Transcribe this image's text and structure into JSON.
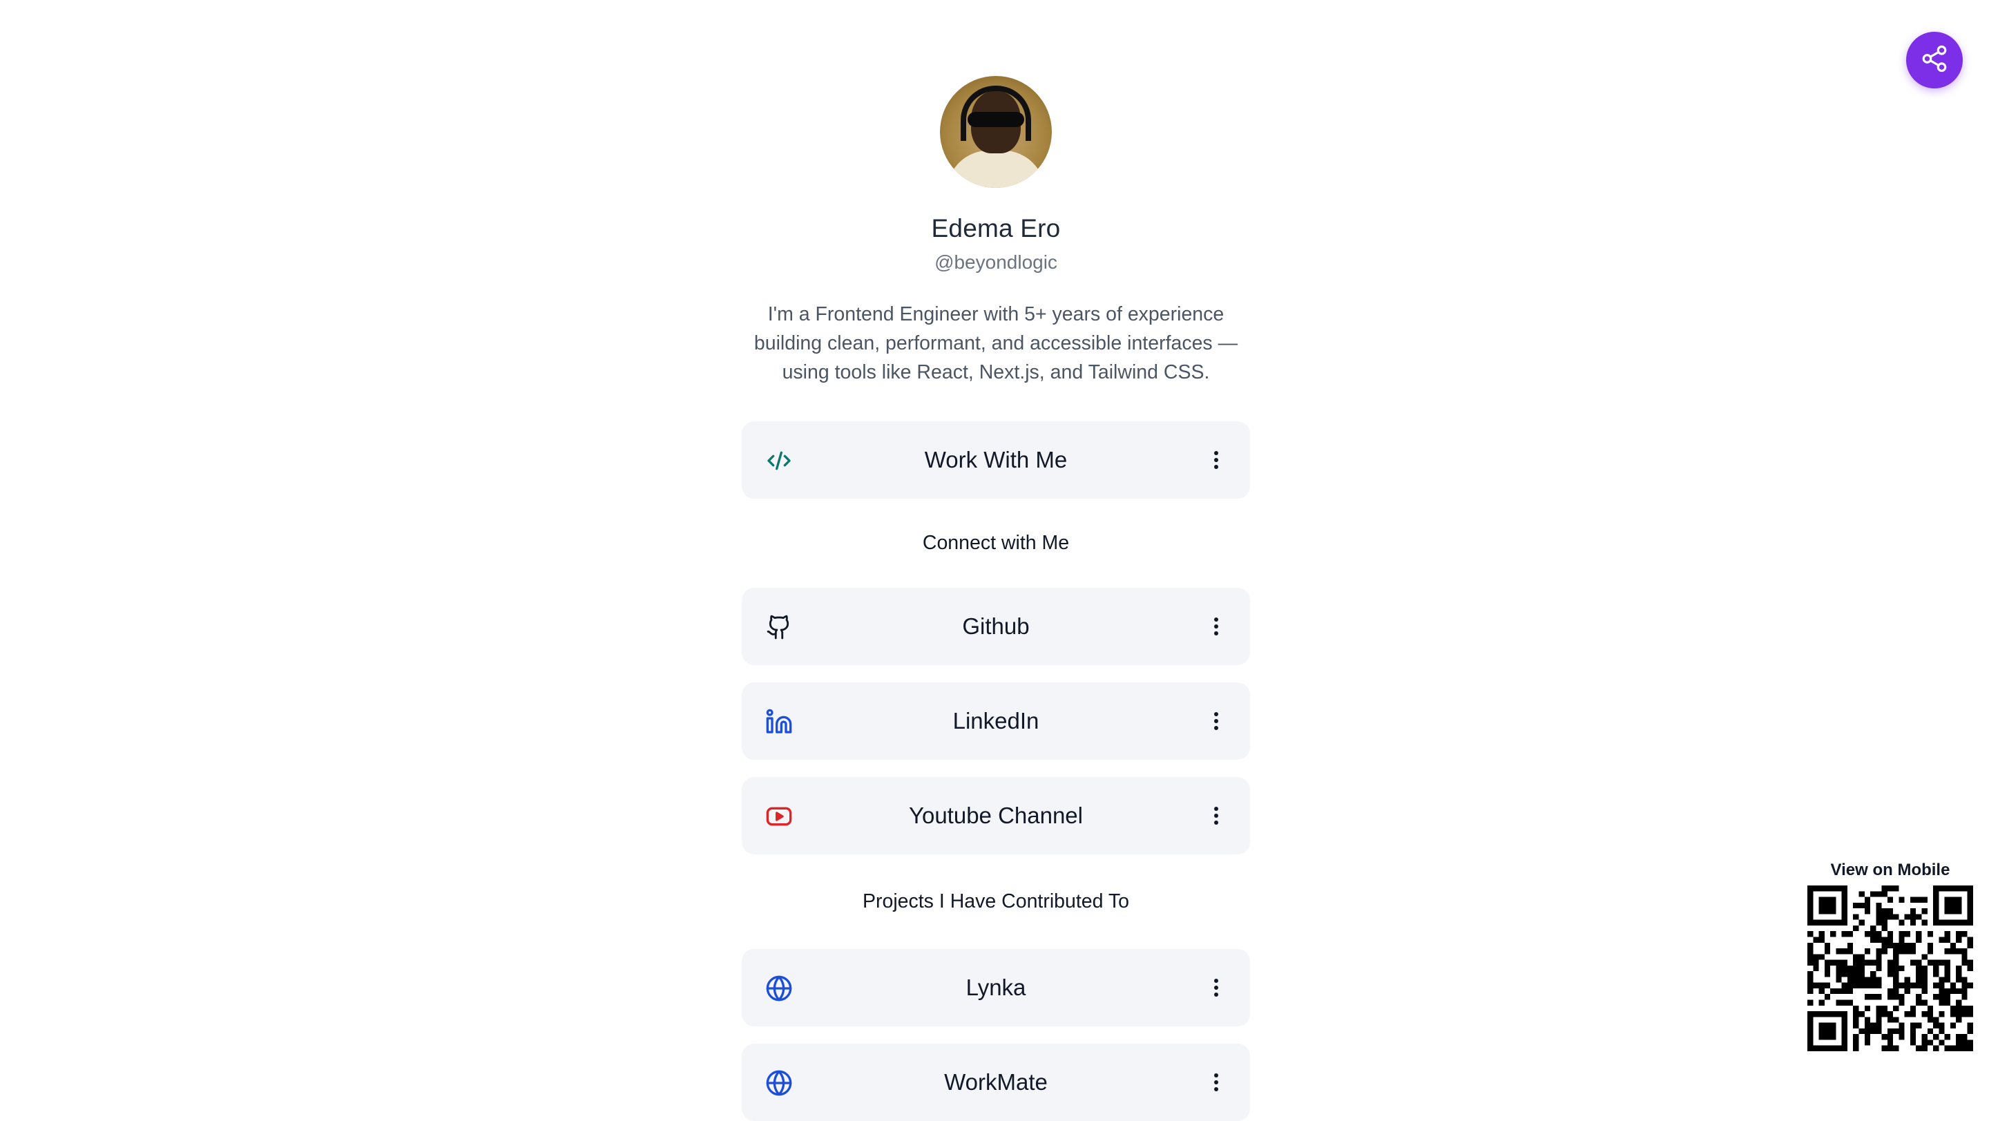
{
  "profile": {
    "name": "Edema Ero",
    "handle": "@beyondlogic",
    "bio": "I'm a Frontend Engineer with 5+ years of experience building clean, performant, and accessible interfaces — using tools like React, Next.js, and Tailwind CSS."
  },
  "links": {
    "work": {
      "label": "Work With Me",
      "icon": "code-icon",
      "color": "#0f766e"
    },
    "connect_title": "Connect with Me",
    "github": {
      "label": "Github",
      "icon": "github-icon",
      "color": "#111827"
    },
    "linkedin": {
      "label": "LinkedIn",
      "icon": "linkedin-icon",
      "color": "#1d4ed8"
    },
    "youtube": {
      "label": "Youtube Channel",
      "icon": "youtube-icon",
      "color": "#dc2626"
    },
    "projects_title": "Projects I Have Contributed To",
    "lynka": {
      "label": "Lynka",
      "icon": "globe-icon",
      "color": "#1d4ed8"
    },
    "next_project": {
      "label": "WorkMate",
      "icon": "globe-icon",
      "color": "#1d4ed8"
    }
  },
  "share": {
    "icon": "share-icon",
    "color": "#7c2fe6"
  },
  "qr": {
    "label": "View on Mobile",
    "icon": "qr-code"
  }
}
